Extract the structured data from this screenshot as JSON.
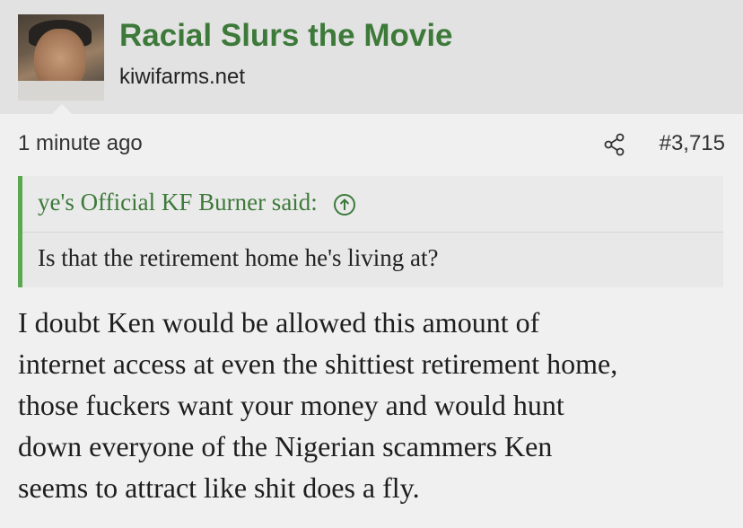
{
  "thread": {
    "title": "Racial Slurs the Movie",
    "site": "kiwifarms.net"
  },
  "post": {
    "timestamp": "1 minute ago",
    "number": "#3,715",
    "quote": {
      "author": "ye's Official KF Burner said:",
      "text": "Is that the retirement home he's living at?"
    },
    "body_lines": [
      "I doubt Ken would be allowed this amount of",
      "internet access at even the shittiest retirement home,",
      "those fuckers want your money and would hunt",
      "down everyone of the Nigerian scammers Ken",
      "seems to attract like shit does a fly."
    ]
  },
  "icons": {
    "share": "share-icon",
    "quote_jump": "arrow-up-circle-icon"
  },
  "colors": {
    "accent_green": "#3d7a3a",
    "quote_border": "#5aa84f"
  }
}
